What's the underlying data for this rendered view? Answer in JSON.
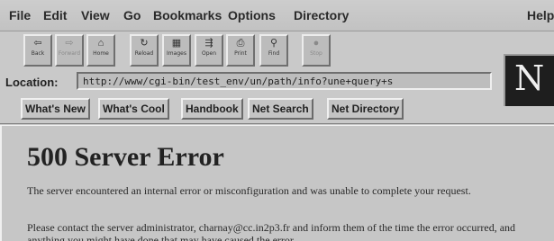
{
  "menubar": {
    "items": [
      "File",
      "Edit",
      "View",
      "Go",
      "Bookmarks",
      "Options",
      "Directory"
    ],
    "help": "Help"
  },
  "toolbar": {
    "buttons": [
      {
        "label": "Back",
        "icon": "back-arrow-icon",
        "glyph": "⇦",
        "enabled": true
      },
      {
        "label": "Forward",
        "icon": "forward-arrow-icon",
        "glyph": "⇨",
        "enabled": false
      },
      {
        "label": "Home",
        "icon": "home-icon",
        "glyph": "⌂",
        "enabled": true
      },
      {
        "label": "Reload",
        "icon": "reload-icon",
        "glyph": "↻",
        "enabled": true
      },
      {
        "label": "Images",
        "icon": "images-icon",
        "glyph": "▦",
        "enabled": true
      },
      {
        "label": "Open",
        "icon": "open-icon",
        "glyph": "⇶",
        "enabled": true
      },
      {
        "label": "Print",
        "icon": "printer-icon",
        "glyph": "⎙",
        "enabled": true
      },
      {
        "label": "Find",
        "icon": "binoculars-icon",
        "glyph": "⚲",
        "enabled": true
      },
      {
        "label": "Stop",
        "icon": "stop-icon",
        "glyph": "●",
        "enabled": false
      }
    ]
  },
  "location": {
    "label": "Location:",
    "value": "http://www/cgi-bin/test_env/un/path/info?une+query+s"
  },
  "logo": {
    "letter": "N"
  },
  "directory_buttons": [
    "What's New",
    "What's Cool",
    "Handbook",
    "Net Search",
    "Net Directory"
  ],
  "page": {
    "title": "500 Server Error",
    "para1": "The server encountered an internal error or misconfiguration and was unable to complete your request.",
    "para2": "Please contact the server administrator, charnay@cc.in2p3.fr and inform them of the time the error occurred, and anything you might have done that may have caused the error."
  }
}
